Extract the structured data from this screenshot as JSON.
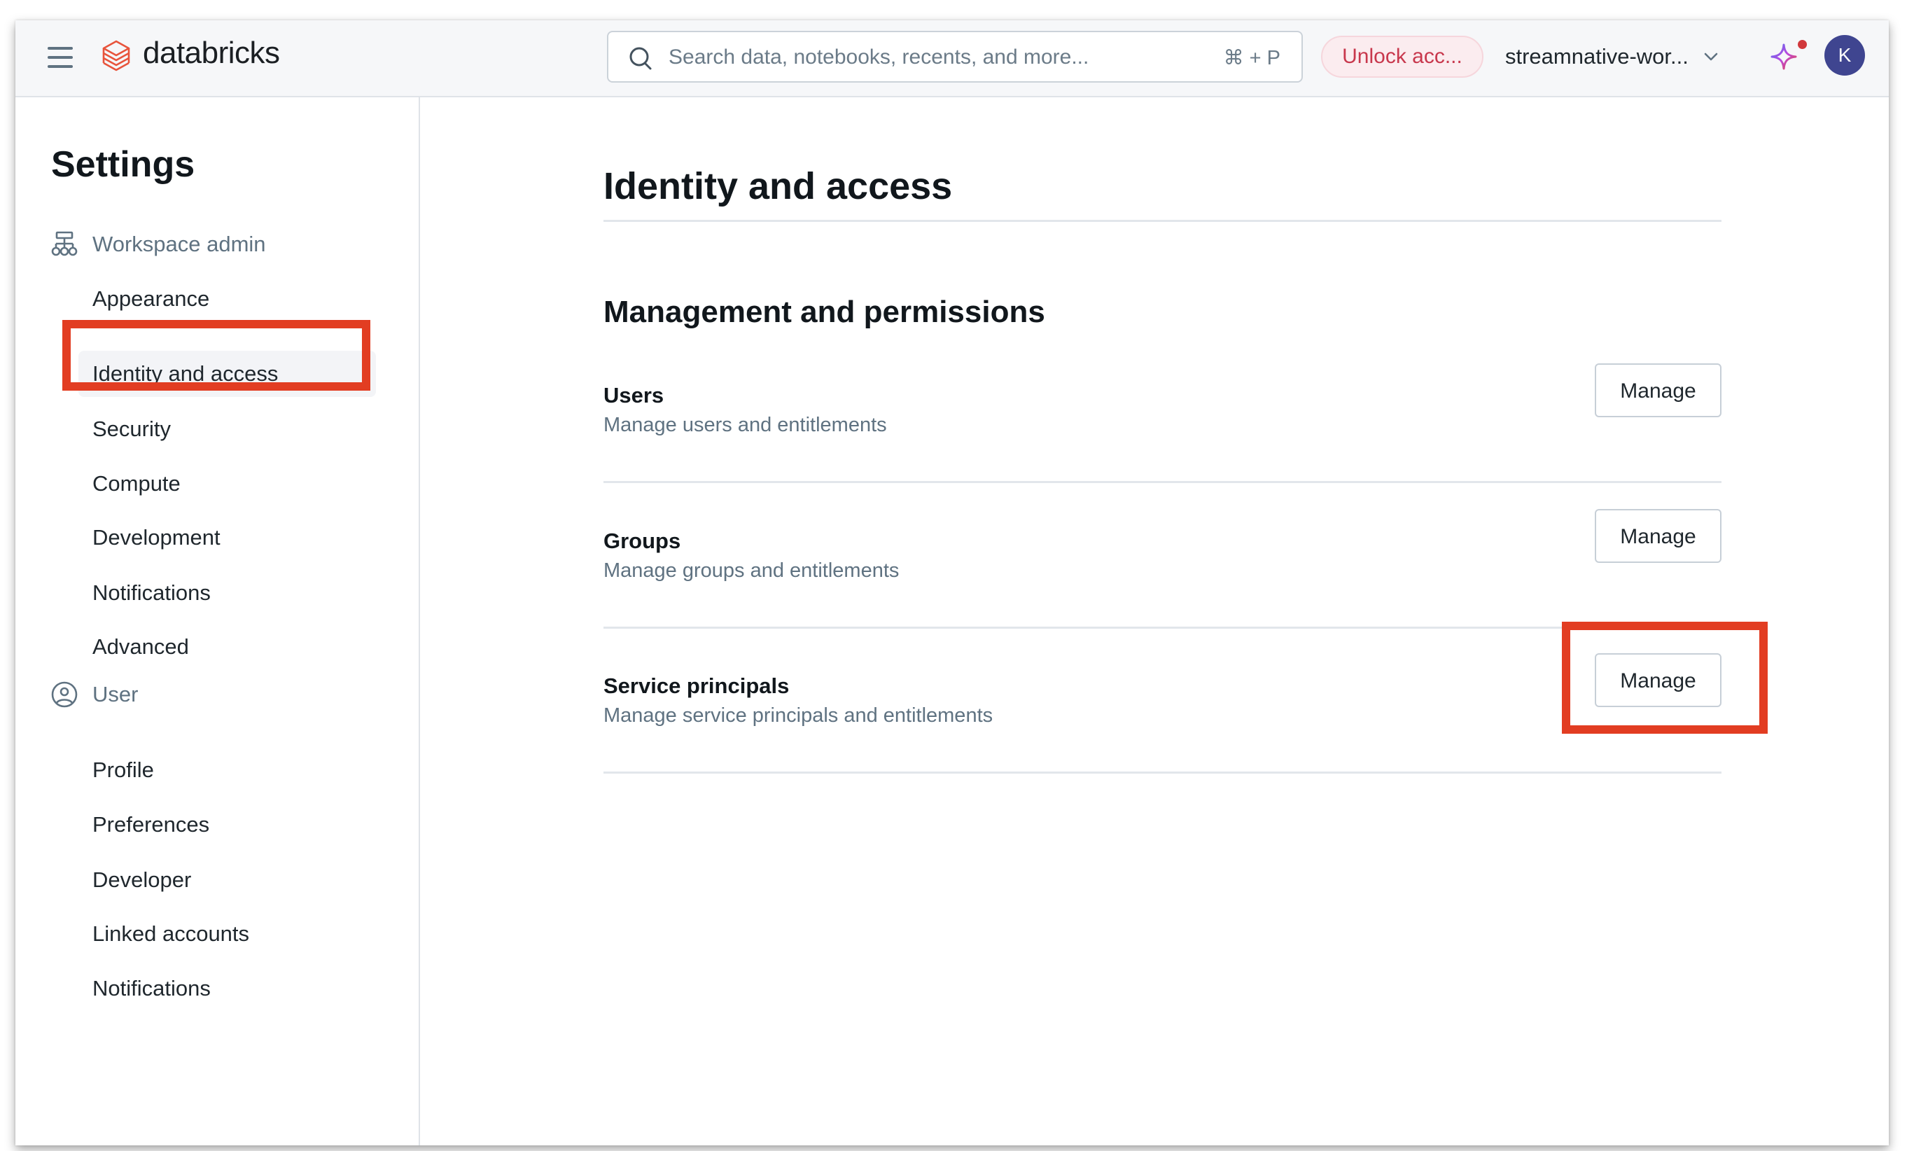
{
  "header": {
    "menu_icon": "hamburger-menu-icon",
    "logo_icon": "databricks-layers-icon",
    "brand": "databricks",
    "search": {
      "placeholder": "Search data, notebooks, recents, and more...",
      "shortcut": "⌘ + P",
      "icon": "search-icon"
    },
    "unlock_label": "Unlock acc...",
    "workspace_name": "streamnative-wor...",
    "assistant_icon": "sparkle-icon",
    "avatar_initial": "K",
    "colors": {
      "avatar_bg": "#3f4590",
      "unlock_text": "#c8384d",
      "brand_red": "#e8543c"
    }
  },
  "sidebar": {
    "title": "Settings",
    "sections": [
      {
        "label": "Workspace admin",
        "icon": "workspace-admin-hierarchy-icon",
        "items": [
          {
            "label": "Appearance",
            "active": false
          },
          {
            "label": "Identity and access",
            "active": true
          },
          {
            "label": "Security",
            "active": false
          },
          {
            "label": "Compute",
            "active": false
          },
          {
            "label": "Development",
            "active": false
          },
          {
            "label": "Notifications",
            "active": false
          },
          {
            "label": "Advanced",
            "active": false
          }
        ]
      },
      {
        "label": "User",
        "icon": "user-circle-icon",
        "items": [
          {
            "label": "Profile",
            "active": false
          },
          {
            "label": "Preferences",
            "active": false
          },
          {
            "label": "Developer",
            "active": false
          },
          {
            "label": "Linked accounts",
            "active": false
          },
          {
            "label": "Notifications",
            "active": false
          }
        ]
      }
    ]
  },
  "main": {
    "page_title": "Identity and access",
    "section_title": "Management and permissions",
    "rows": [
      {
        "title": "Users",
        "description": "Manage users and entitlements",
        "button": "Manage"
      },
      {
        "title": "Groups",
        "description": "Manage groups and entitlements",
        "button": "Manage"
      },
      {
        "title": "Service principals",
        "description": "Manage service principals and entitlements",
        "button": "Manage"
      }
    ]
  },
  "annotations": {
    "highlight_color": "#e23d22",
    "highlighted": [
      "sidebar: Identity and access",
      "Service principals: Manage"
    ]
  }
}
